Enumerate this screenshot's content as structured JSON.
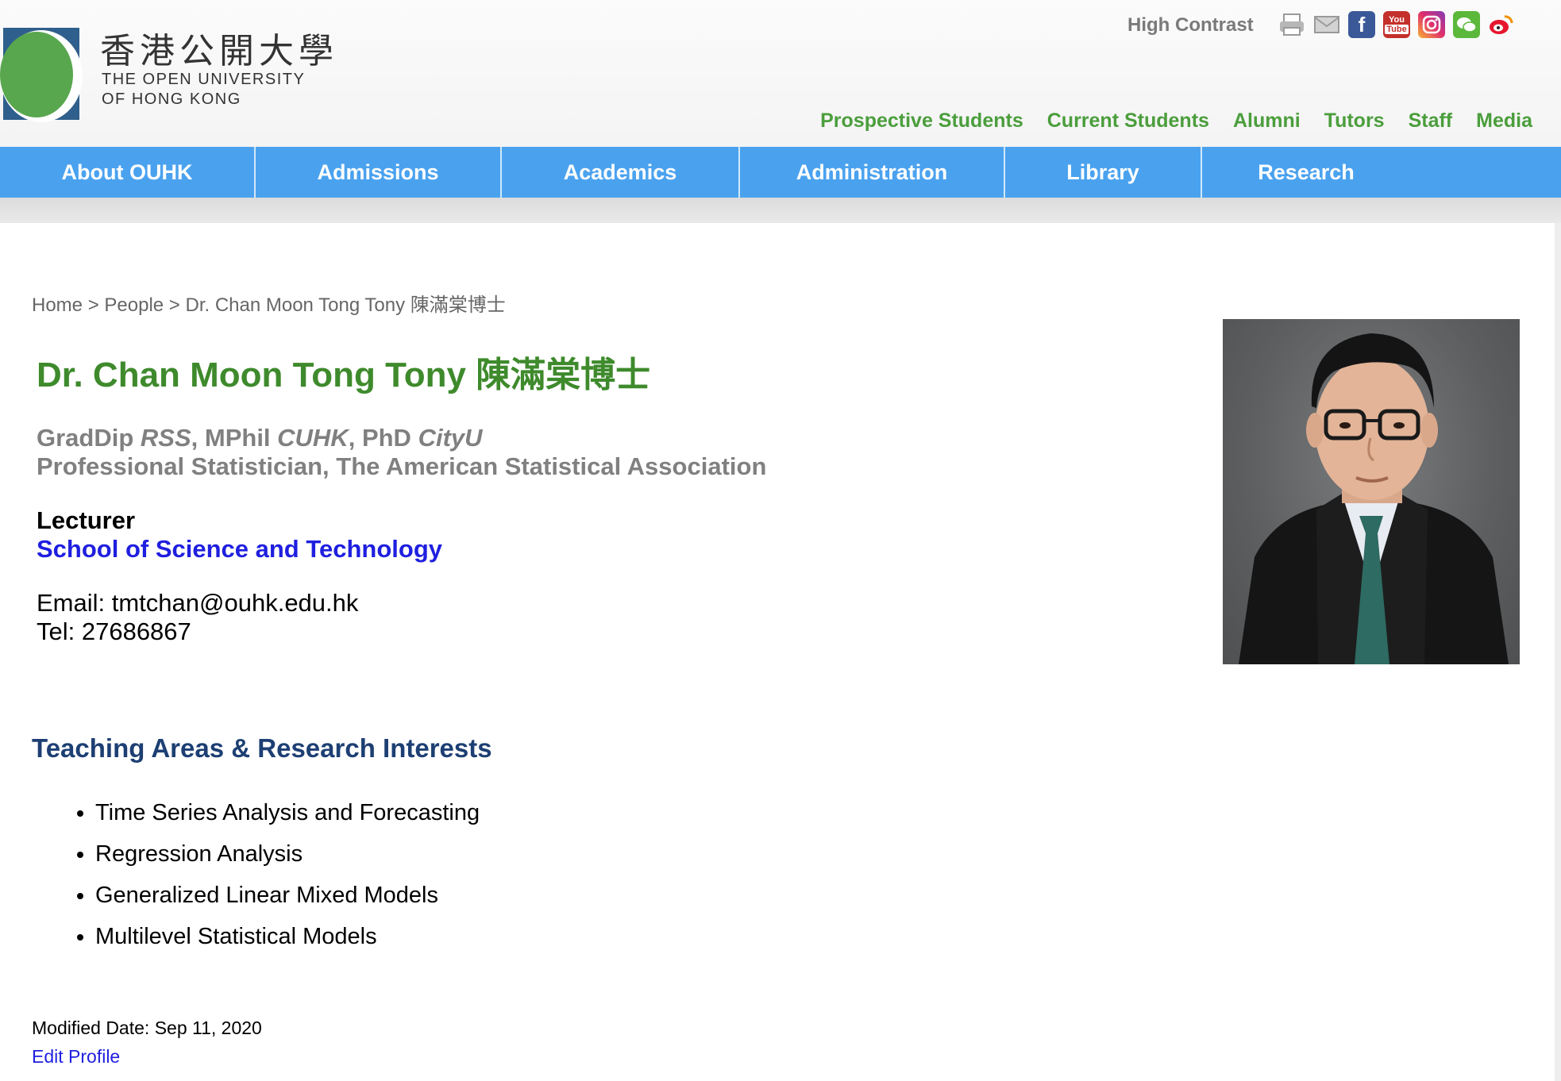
{
  "header": {
    "logo_zh": "香港公開大學",
    "logo_en_line1": "THE OPEN UNIVERSITY",
    "logo_en_line2": "OF HONG KONG",
    "high_contrast": "High Contrast",
    "social_icons": [
      "print-icon",
      "mail-icon",
      "facebook-icon",
      "youtube-icon",
      "instagram-icon",
      "wechat-icon",
      "weibo-icon"
    ],
    "audience_nav": [
      "Prospective Students",
      "Current Students",
      "Alumni",
      "Tutors",
      "Staff",
      "Media"
    ]
  },
  "main_menu": [
    "About OUHK",
    "Admissions",
    "Academics",
    "Administration",
    "Library",
    "Research"
  ],
  "breadcrumb": {
    "home": "Home",
    "sep": ">",
    "people": "People",
    "current": "Dr. Chan Moon Tong Tony 陳滿棠博士"
  },
  "profile": {
    "name": "Dr. Chan Moon Tong Tony 陳滿棠博士",
    "qual_1a": "GradDip ",
    "qual_1b": "RSS",
    "qual_1c": ", MPhil ",
    "qual_1d": "CUHK",
    "qual_1e": ", PhD ",
    "qual_1f": "CityU",
    "qual_2": "Professional Statistician, The American Statistical Association",
    "position": "Lecturer",
    "school": "School of Science and Technology",
    "email": "Email: tmtchan@ouhk.edu.hk",
    "tel": "Tel: 27686867"
  },
  "teaching": {
    "title": "Teaching Areas & Research Interests",
    "items": [
      "Time Series Analysis and Forecasting",
      "Regression Analysis",
      "Generalized Linear Mixed Models",
      "Multilevel Statistical Models"
    ]
  },
  "footer": {
    "modified": "Modified Date: Sep 11, 2020",
    "edit": "Edit Profile"
  },
  "colors": {
    "green": "#4b9e3c",
    "menu_blue": "#4aa2ef",
    "link_blue": "#1f1fe0",
    "heading_navy": "#1d3f73"
  }
}
